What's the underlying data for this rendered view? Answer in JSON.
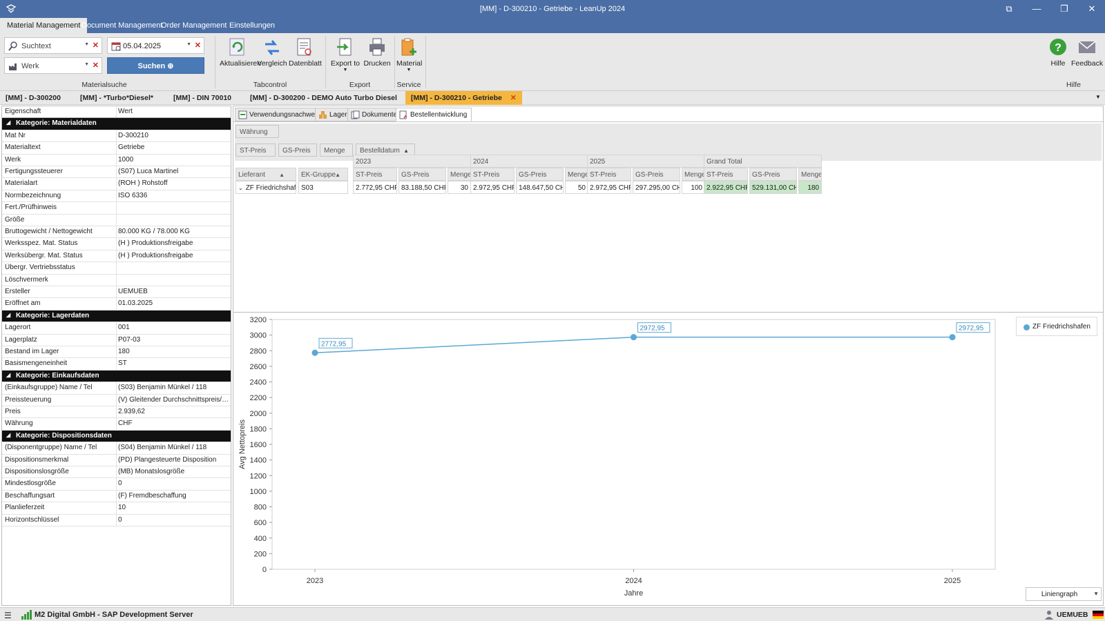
{
  "window": {
    "title": "[MM] - D-300210 - Getriebe - LeanUp 2024"
  },
  "menu": [
    "Material Management",
    "Document Management",
    "Order Management",
    "Einstellungen"
  ],
  "ribbon": {
    "search_placeholder": "Suchtext",
    "date_value": "05.04.2025",
    "werk_placeholder": "Werk",
    "search_button": "Suchen",
    "buttons": {
      "aktualisieren": "Aktualisieren",
      "vergleich": "Vergleich",
      "datenblatt": "Datenblatt",
      "export_to": "Export to",
      "drucken": "Drucken",
      "material": "Material",
      "hilfe": "Hilfe",
      "feedback": "Feedback"
    },
    "groups": {
      "materialsuche": "Materialsuche",
      "tabcontrol": "Tabcontrol",
      "export": "Export",
      "service": "Service",
      "hilfe": "Hilfe"
    }
  },
  "doc_tabs": [
    "[MM] - D-300200",
    "[MM] - *Turbo*Diesel*",
    "[MM] - DIN 70010",
    "[MM] - D-300200 - DEMO Auto Turbo Diesel",
    "[MM] - D-300210 - Getriebe"
  ],
  "props": {
    "header": {
      "k": "Eigenschaft",
      "v": "Wert"
    },
    "rows": [
      {
        "cat": "Kategorie: Materialdaten"
      },
      {
        "k": "Mat Nr",
        "v": "D-300210"
      },
      {
        "k": "Materialtext",
        "v": "Getriebe"
      },
      {
        "k": "Werk",
        "v": "1000"
      },
      {
        "k": "Fertigungssteuerer",
        "v": "(S07) Luca Martinel"
      },
      {
        "k": "Materialart",
        "v": "(ROH ) Rohstoff"
      },
      {
        "k": "Normbezeichnung",
        "v": "ISO 6336"
      },
      {
        "k": "Fert./Prüfhinweis",
        "v": ""
      },
      {
        "k": "Größe",
        "v": ""
      },
      {
        "k": "Bruttogewicht / Nettogewicht",
        "v": "80.000  KG  / 78.000  KG"
      },
      {
        "k": "Werksspez. Mat. Status",
        "v": "(H ) Produktionsfreigabe"
      },
      {
        "k": "Werksübergr. Mat. Status",
        "v": "(H ) Produktionsfreigabe"
      },
      {
        "k": "Übergr. Vertriebsstatus",
        "v": ""
      },
      {
        "k": "Löschvermerk",
        "v": ""
      },
      {
        "k": "Ersteller",
        "v": "UEMUEB"
      },
      {
        "k": "Eröffnet am",
        "v": "01.03.2025"
      },
      {
        "cat": "Kategorie: Lagerdaten"
      },
      {
        "k": "Lagerort",
        "v": "001"
      },
      {
        "k": "Lagerplatz",
        "v": "P07-03"
      },
      {
        "k": "Bestand im Lager",
        "v": "180"
      },
      {
        "k": "Basismengeneinheit",
        "v": "ST"
      },
      {
        "cat": "Kategorie: Einkaufsdaten"
      },
      {
        "k": "(Einkaufsgruppe) Name / Tel",
        "v": "(S03) Benjamin Münkel   / 118"
      },
      {
        "k": "Preissteuerung",
        "v": "(V) Gleitender Durchschnittspreis/Peri..."
      },
      {
        "k": "Preis",
        "v": "2.939,62"
      },
      {
        "k": "Währung",
        "v": "CHF"
      },
      {
        "cat": "Kategorie: Dispositionsdaten"
      },
      {
        "k": "(Disponentgruppe) Name / Tel",
        "v": "(S04) Benjamin Münkel   / 118"
      },
      {
        "k": "Dispositionsmerkmal",
        "v": "(PD) Plangesteuerte Disposition"
      },
      {
        "k": "Dispositionslosgröße",
        "v": "(MB) Monatslosgröße"
      },
      {
        "k": "Mindestlosgröße",
        "v": "0"
      },
      {
        "k": "Beschaffungsart",
        "v": "(F) Fremdbeschaffung"
      },
      {
        "k": "Planlieferzeit",
        "v": "10"
      },
      {
        "k": "Horizontschlüssel",
        "v": "0"
      }
    ]
  },
  "sub_tabs": [
    "Verwendungsnachweis",
    "Lager",
    "Dokumente",
    "Bestellentwicklung"
  ],
  "pivot": {
    "filter_field": "Währung",
    "data_fields": [
      "ST-Preis",
      "GS-Preis",
      "Menge"
    ],
    "column_field": "Bestelldatum",
    "row_fields": [
      "Lieferant",
      "EK-Gruppe"
    ],
    "years": [
      "2023",
      "2024",
      "2025",
      "Grand Total"
    ],
    "measures": [
      "ST-Preis",
      "GS-Preis",
      "Menge"
    ],
    "row": {
      "lieferant": "ZF Friedrichshafen",
      "ek_gruppe": "S03",
      "cells": [
        [
          "2.772,95 CHF",
          "83.188,50 CHF",
          "30"
        ],
        [
          "2.972,95 CHF",
          "148.647,50 CHF",
          "50"
        ],
        [
          "2.972,95 CHF",
          "297.295,00 CHF",
          "100"
        ],
        [
          "2.922,95 CHF",
          "529.131,00 CHF",
          "180"
        ]
      ]
    }
  },
  "chart_data": {
    "type": "line",
    "x": [
      "2023",
      "2024",
      "2025"
    ],
    "series": [
      {
        "name": "ZF Friedrichshafen",
        "values": [
          2772.95,
          2972.95,
          2972.95
        ],
        "labels": [
          "2772,95",
          "2972,95",
          "2972,95"
        ],
        "color": "#5ba8d4"
      }
    ],
    "xlabel": "Jahre",
    "ylabel": "Avg Nettopreis",
    "ylim": [
      0,
      3200
    ],
    "yticks": [
      0,
      200,
      400,
      600,
      800,
      1000,
      1200,
      1400,
      1600,
      1800,
      2000,
      2200,
      2400,
      2600,
      2800,
      3000,
      3200
    ],
    "grid": false,
    "legend": "top-right"
  },
  "chart_type_select": "Liniengraph",
  "status": {
    "server": "M2 Digital GmbH - SAP Development Server",
    "user": "UEMUEB"
  }
}
